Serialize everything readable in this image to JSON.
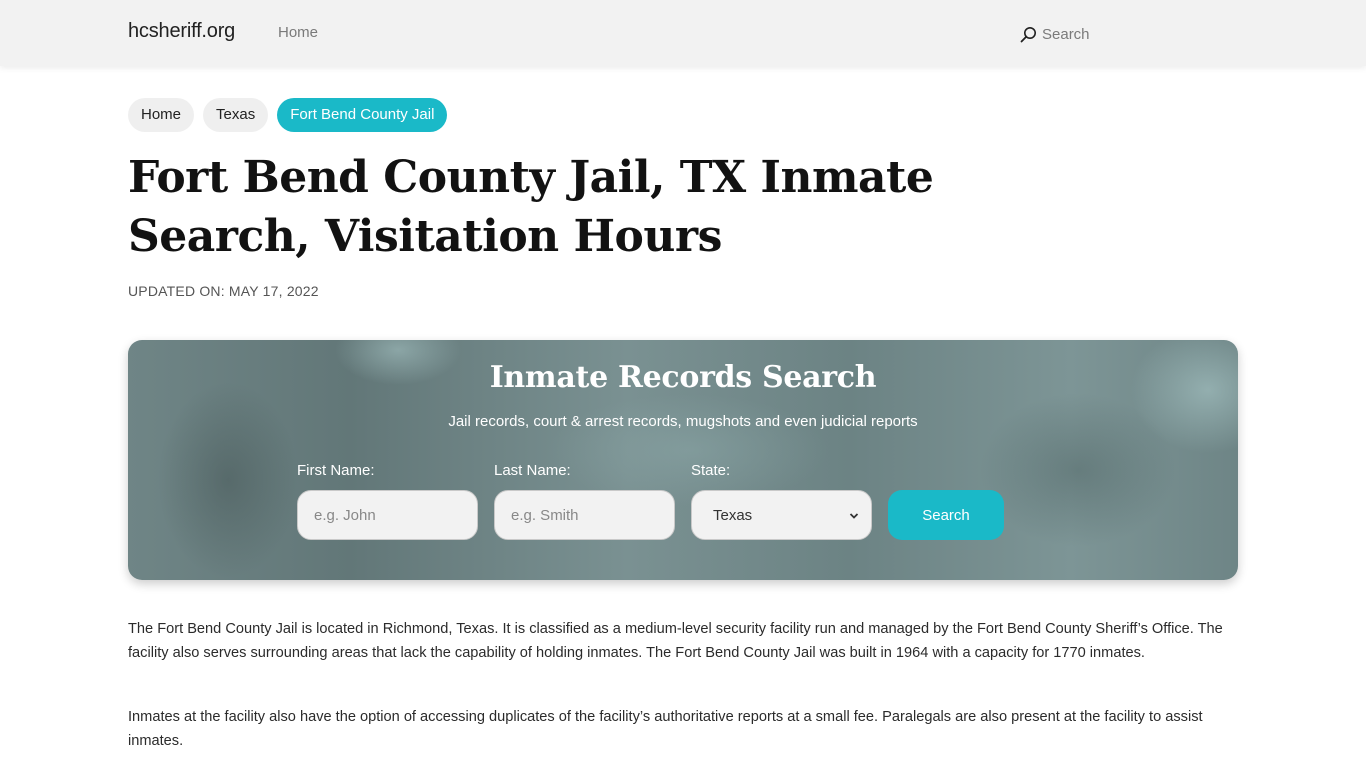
{
  "nav": {
    "brand": "hcsheriff.org",
    "home_link": "Home",
    "search_label": "Search",
    "search_icon": "search-icon"
  },
  "breadcrumb": [
    {
      "label": "Home",
      "active": false
    },
    {
      "label": "Texas",
      "active": false
    },
    {
      "label": "Fort Bend County Jail",
      "active": true
    }
  ],
  "page": {
    "title": "Fort Bend County Jail, TX Inmate Search, Visitation Hours",
    "updated": "UPDATED ON: MAY 17, 2022"
  },
  "search_card": {
    "title": "Inmate Records Search",
    "subtitle": "Jail records, court & arrest records, mugshots and even judicial reports",
    "first_name": {
      "label": "First Name:",
      "placeholder": "e.g. John",
      "value": ""
    },
    "last_name": {
      "label": "Last Name:",
      "placeholder": "e.g. Smith",
      "value": ""
    },
    "state": {
      "label": "State:",
      "selected": "Texas"
    },
    "button_label": "Search"
  },
  "content": {
    "paragraphs": [
      "The Fort Bend County Jail is located in Richmond, Texas. It is classified as a medium-level security facility run and managed by the Fort Bend County Sheriff’s Office. The facility also serves surrounding areas that lack the capability of holding inmates. The Fort Bend County Jail was built in 1964 with a capacity for 1770 inmates.",
      "Inmates at the facility also have the option of accessing duplicates of the facility’s authoritative reports at a small fee. Paralegals are also present at the facility to assist inmates."
    ]
  },
  "colors": {
    "accent": "#1ab9c8",
    "navbar_bg": "#f2f2f2",
    "card_bg": "#6f8586"
  }
}
